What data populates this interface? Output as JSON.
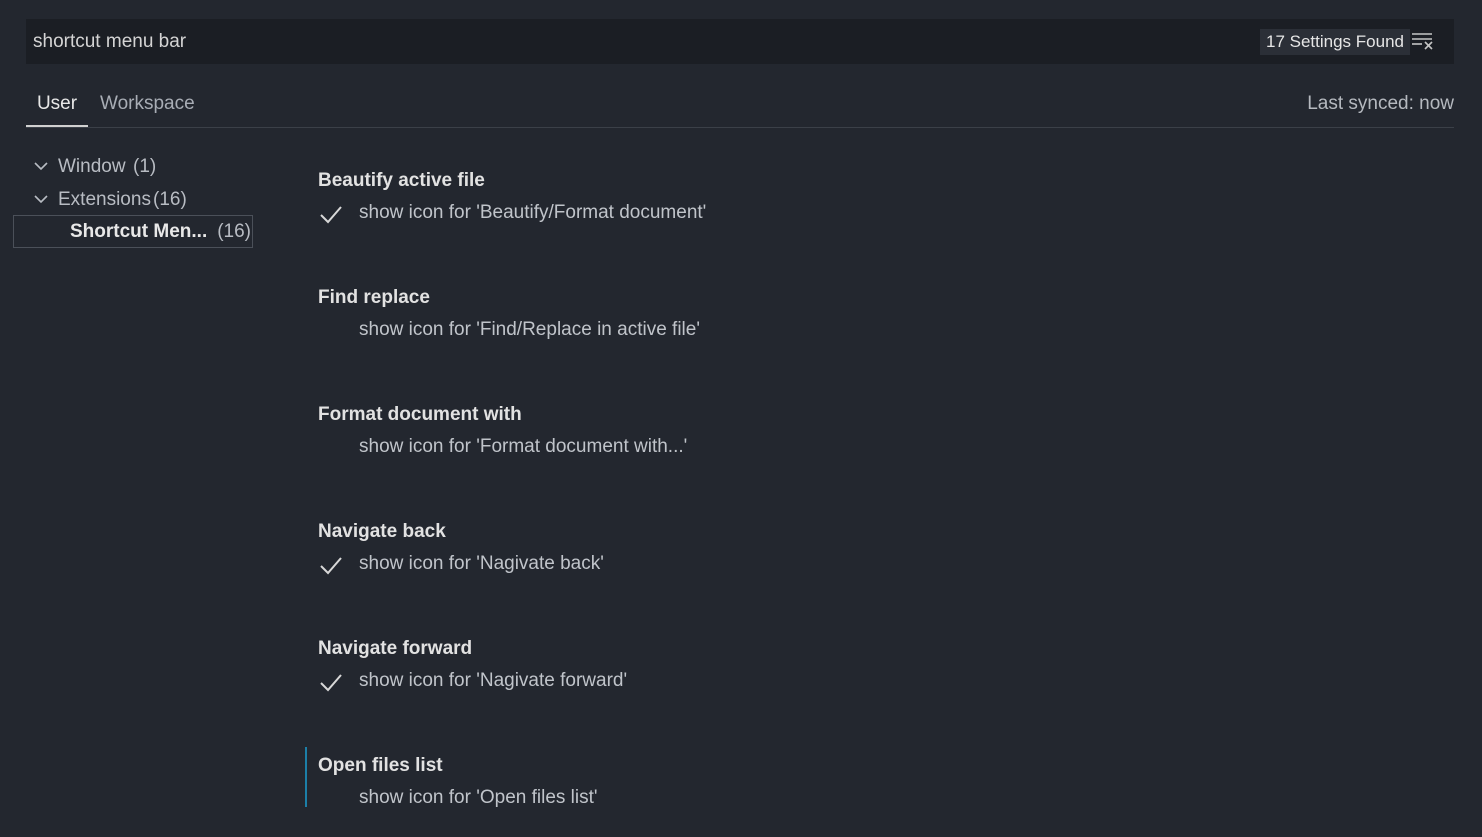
{
  "search": {
    "value": "shortcut menu bar",
    "results_badge": "17 Settings Found",
    "clear_icon": "clear-filter-icon"
  },
  "tabs": [
    {
      "label": "User",
      "active": true
    },
    {
      "label": "Workspace",
      "active": false
    }
  ],
  "last_synced": "Last synced: now",
  "toc": {
    "items": [
      {
        "label": "Window",
        "count": "(1)",
        "icon": "chevron-down-icon"
      },
      {
        "label": "Extensions",
        "count": "(16)",
        "icon": "chevron-down-icon"
      }
    ],
    "selected": {
      "label": "Shortcut Men...",
      "count": "(16)"
    }
  },
  "settings": [
    {
      "title": "Beautify active file",
      "description": "show icon for 'Beautify/Format document'",
      "checked": true
    },
    {
      "title": "Find replace",
      "description": "show icon for 'Find/Replace in active file'",
      "checked": false
    },
    {
      "title": "Format document with",
      "description": "show icon for 'Format document with...'",
      "checked": false
    },
    {
      "title": "Navigate back",
      "description": "show icon for 'Nagivate back'",
      "checked": true
    },
    {
      "title": "Navigate forward",
      "description": "show icon for 'Nagivate forward'",
      "checked": true
    },
    {
      "title": "Open files list",
      "description": "show icon for 'Open files list'",
      "checked": false,
      "focused": true
    }
  ],
  "colors": {
    "background": "#23272f",
    "input_background": "#1b1e24",
    "focus_accent": "#1c7fa8"
  }
}
